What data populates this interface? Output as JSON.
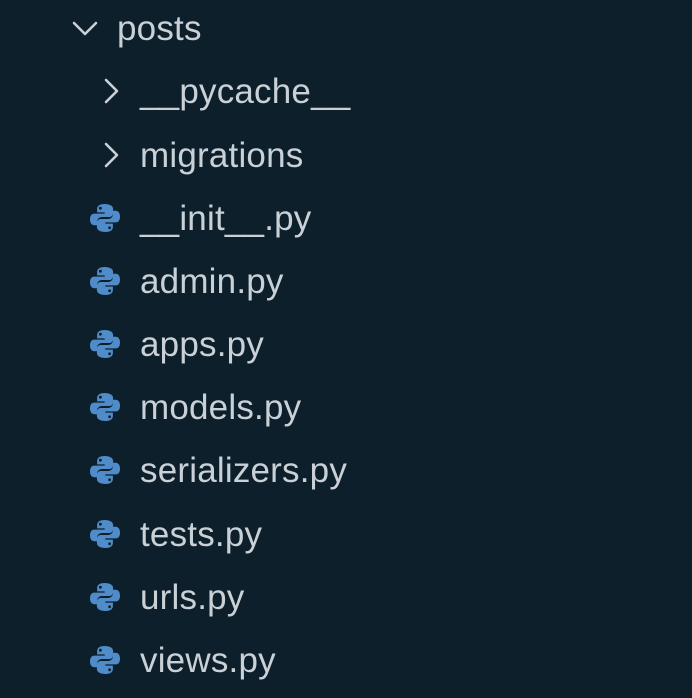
{
  "explorer": {
    "root": {
      "label": "posts",
      "expanded": true,
      "icon": "chevron-down-icon"
    },
    "folders": [
      {
        "label": "__pycache__",
        "icon": "chevron-right-icon"
      },
      {
        "label": "migrations",
        "icon": "chevron-right-icon"
      }
    ],
    "files": [
      {
        "label": "__init__.py",
        "icon": "python-icon"
      },
      {
        "label": "admin.py",
        "icon": "python-icon"
      },
      {
        "label": "apps.py",
        "icon": "python-icon"
      },
      {
        "label": "models.py",
        "icon": "python-icon"
      },
      {
        "label": "serializers.py",
        "icon": "python-icon"
      },
      {
        "label": "tests.py",
        "icon": "python-icon"
      },
      {
        "label": "urls.py",
        "icon": "python-icon"
      },
      {
        "label": "views.py",
        "icon": "python-icon"
      }
    ],
    "colors": {
      "background": "#0c1f2b",
      "text": "#c9d1d6",
      "python_icon": "#4f8cc9"
    }
  }
}
